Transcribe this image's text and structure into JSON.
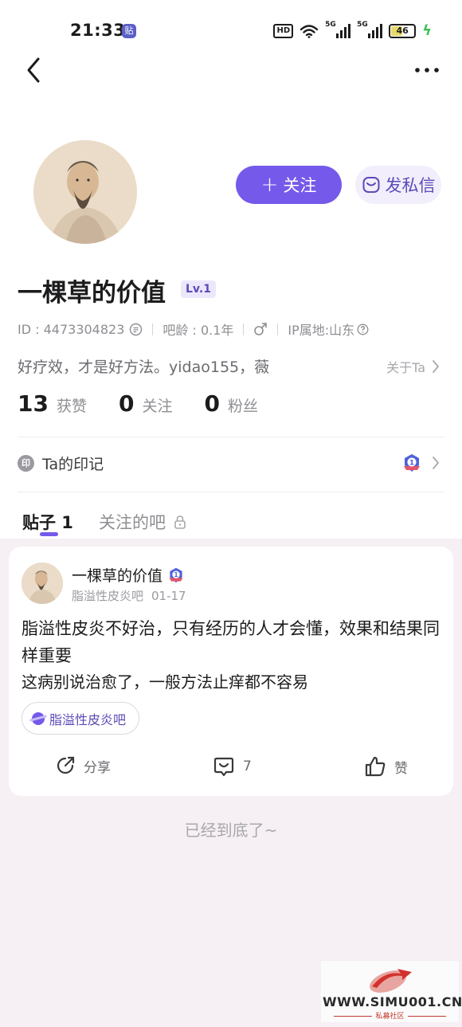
{
  "status_bar": {
    "time": "21:33",
    "notification_badge": "贴",
    "hd_label": "HD",
    "signal_1_label": "5G",
    "signal_2_label": "5G",
    "battery_level": "46"
  },
  "header": {
    "back_icon": "chevron-left-icon",
    "more_icon": "more-horizontal-icon"
  },
  "profile": {
    "name": "一棵草的价值",
    "level": "Lv.1",
    "id_text": "ID : 4473304823",
    "age_text": "吧龄 : 0.1年",
    "gender_icon": "male-icon",
    "ip_text": "IP属地:山东",
    "bio": "好疗效，才是好方法。yidao155，薇",
    "about_label": "关于Ta",
    "follow_label": "关注",
    "message_label": "发私信"
  },
  "stats": [
    {
      "value": "13",
      "label": "获赞"
    },
    {
      "value": "0",
      "label": "关注"
    },
    {
      "value": "0",
      "label": "粉丝"
    }
  ],
  "imprint": {
    "icon_text": "印",
    "label": "Ta的印记"
  },
  "tabs": {
    "posts_label": "贴子 1",
    "bars_label": "关注的吧"
  },
  "post": {
    "author": "一棵草的价值",
    "forum": "脂溢性皮炎吧",
    "date": "01-17",
    "title": "脂溢性皮炎不好治，只有经历的人才会懂，效果和结果同样重要",
    "body": "这病别说治愈了，一般方法止痒都不容易",
    "tag": "脂溢性皮炎吧",
    "share_label": "分享",
    "comment_count": "7",
    "like_label": "赞"
  },
  "footer": {
    "end_text": "已经到底了~"
  },
  "watermark": {
    "text": "WWW.SIMU001.CN",
    "sub": "私募社区"
  },
  "colors": {
    "accent": "#7559ea",
    "page_bg": "#f6eff3"
  }
}
